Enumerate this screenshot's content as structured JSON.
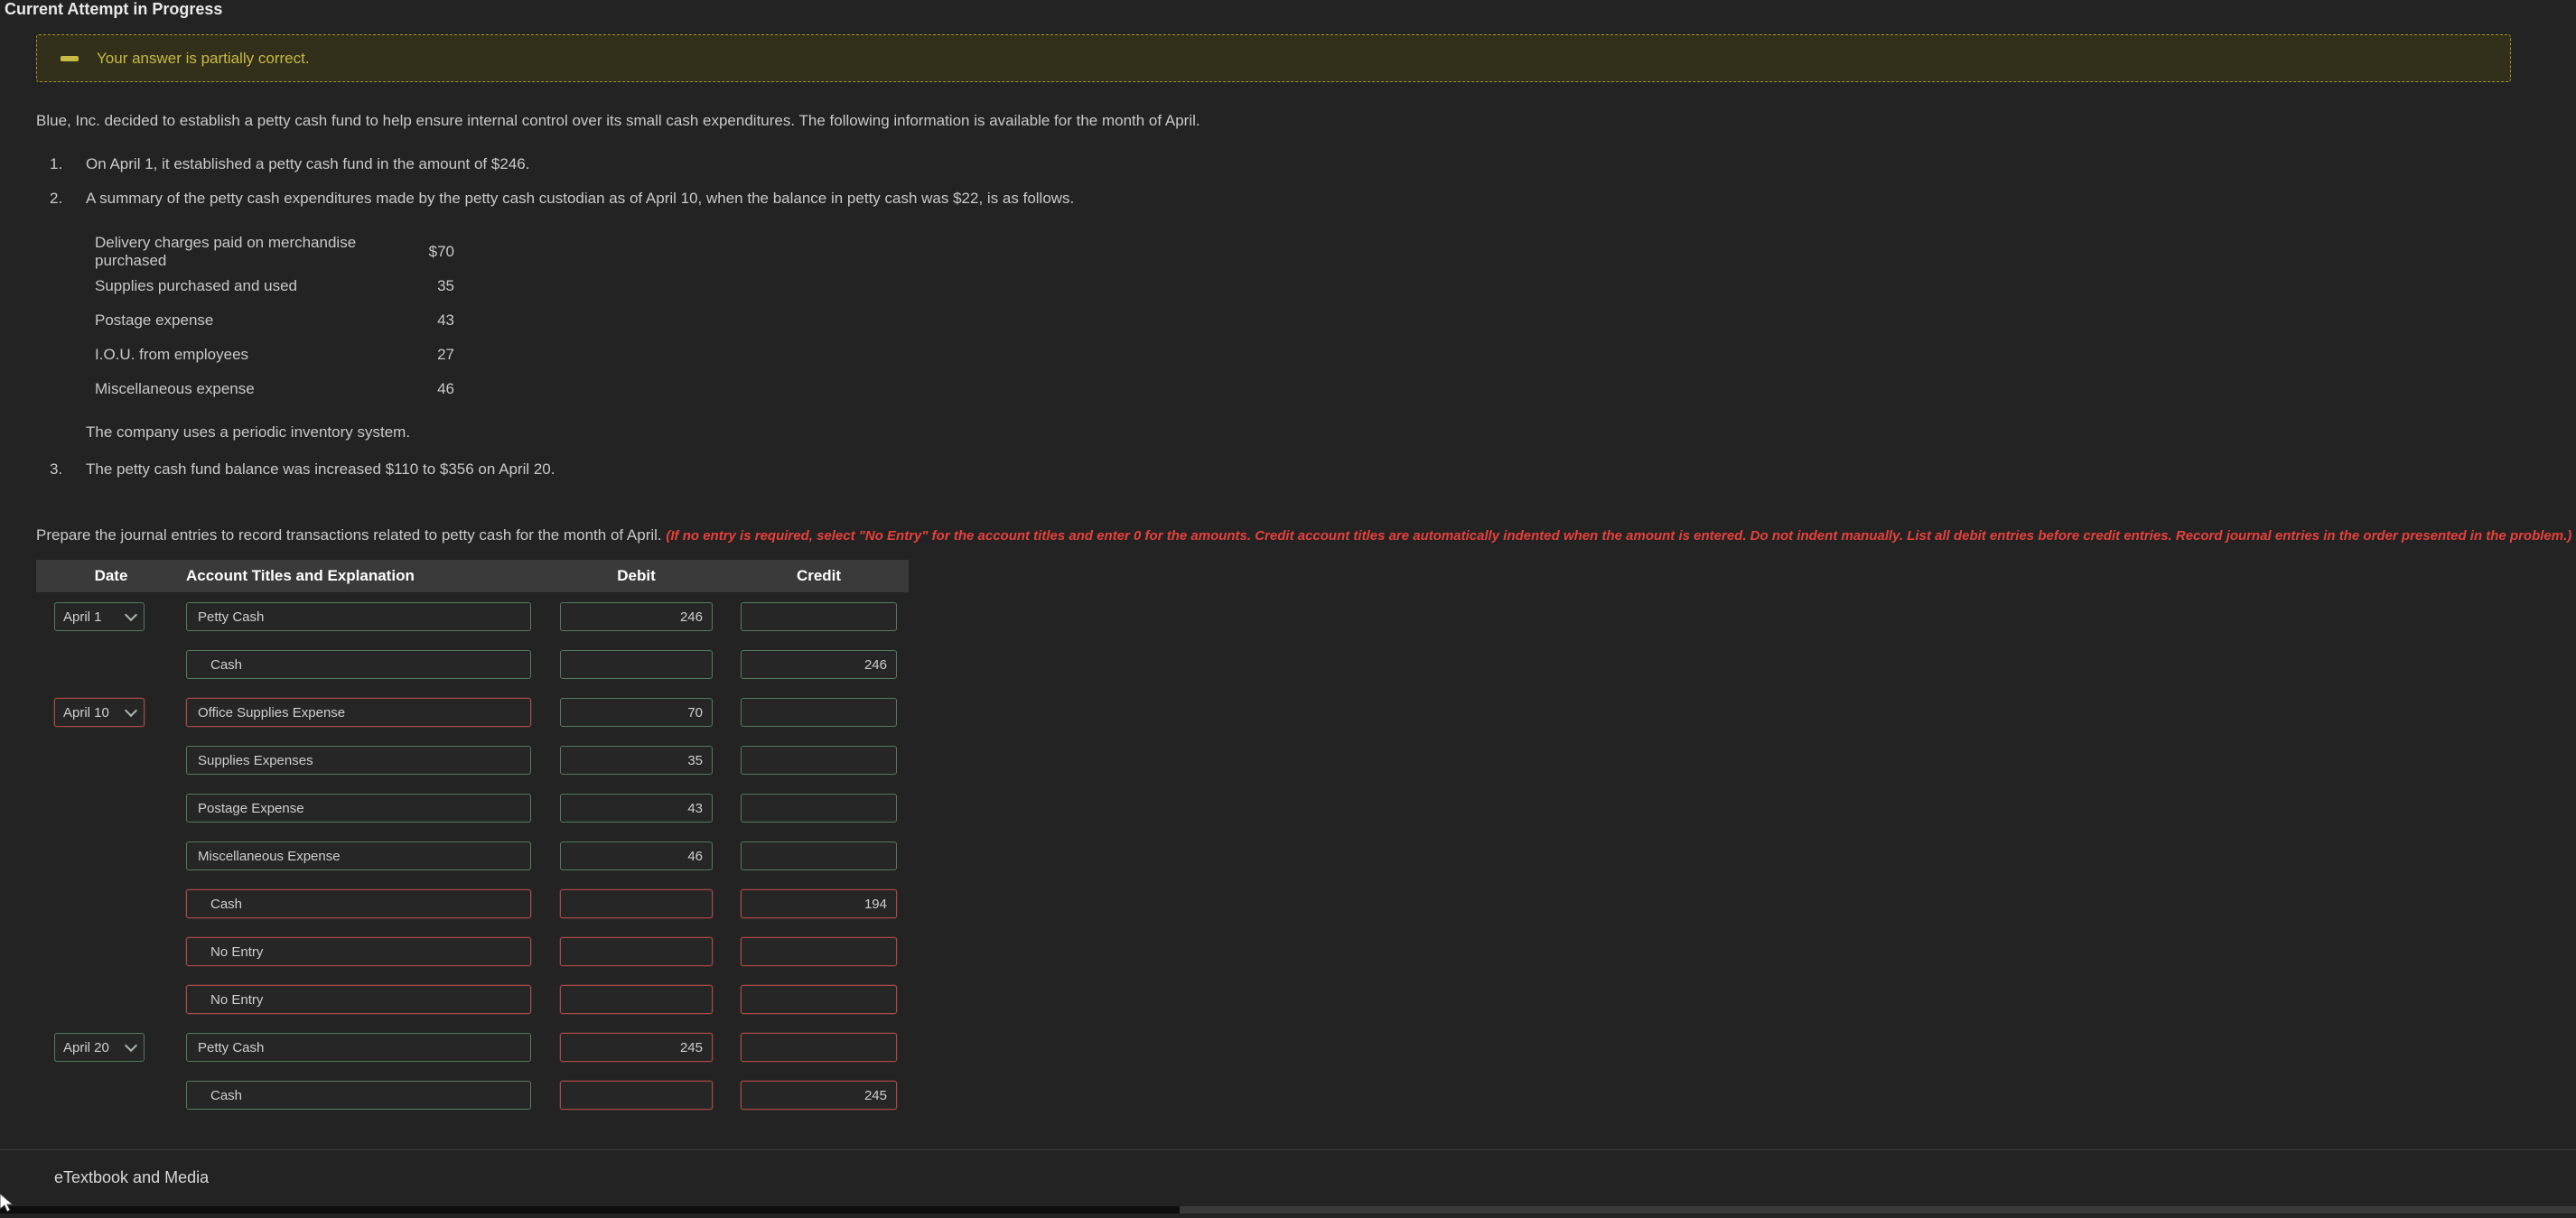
{
  "page": {
    "title": "Current Attempt in Progress",
    "footer_section": "eTextbook and Media"
  },
  "alert": {
    "message": "Your answer is partially correct.",
    "icon": "partially-correct-dash-icon"
  },
  "problem": {
    "intro": "Blue, Inc. decided to establish a petty cash fund to help ensure internal control over its small cash expenditures. The following information is available for the month of April.",
    "items": [
      {
        "number": "1.",
        "text": "On April 1, it established a petty cash fund in the amount of $246."
      },
      {
        "number": "2.",
        "text": "A summary of the petty cash expenditures made by the petty cash custodian as of April 10, when the balance in petty cash was $22, is as follows."
      },
      {
        "number": "3.",
        "text": "The petty cash fund balance was increased $110 to $356 on April 20."
      }
    ],
    "expenditures": [
      {
        "label": "Delivery charges paid on merchandise purchased",
        "amount": "$70"
      },
      {
        "label": "Supplies purchased and used",
        "amount": "35"
      },
      {
        "label": "Postage expense",
        "amount": "43"
      },
      {
        "label": "I.O.U. from employees",
        "amount": "27"
      },
      {
        "label": "Miscellaneous expense",
        "amount": "46"
      }
    ],
    "note": "The company uses a periodic inventory system.",
    "instruction": "Prepare the journal entries to record transactions related to petty cash for the month of April.",
    "instruction_warning": "(If no entry is required, select \"No Entry\" for the account titles and enter 0 for the amounts. Credit account titles are automatically indented when the amount is entered. Do not indent manually. List all debit entries before credit entries. Record journal entries in the order presented in the problem.)"
  },
  "journal": {
    "headers": {
      "date": "Date",
      "account": "Account Titles and Explanation",
      "debit": "Debit",
      "credit": "Credit"
    },
    "rows": [
      {
        "date": "April 1",
        "date_state": "correct",
        "account": "Petty Cash",
        "account_state": "correct",
        "debit": "246",
        "debit_state": "correct",
        "credit": "",
        "credit_state": "correct"
      },
      {
        "date": "",
        "date_state": "",
        "account": "Cash",
        "account_state": "correct",
        "debit": "",
        "debit_state": "correct",
        "credit": "246",
        "credit_state": "correct"
      },
      {
        "date": "April 10",
        "date_state": "incorrect",
        "account": "Office Supplies Expense",
        "account_state": "incorrect",
        "debit": "70",
        "debit_state": "correct",
        "credit": "",
        "credit_state": "correct"
      },
      {
        "date": "",
        "date_state": "",
        "account": "Supplies Expenses",
        "account_state": "correct",
        "debit": "35",
        "debit_state": "correct",
        "credit": "",
        "credit_state": "correct"
      },
      {
        "date": "",
        "date_state": "",
        "account": "Postage Expense",
        "account_state": "correct",
        "debit": "43",
        "debit_state": "correct",
        "credit": "",
        "credit_state": "correct"
      },
      {
        "date": "",
        "date_state": "",
        "account": "Miscellaneous Expense",
        "account_state": "correct",
        "debit": "46",
        "debit_state": "correct",
        "credit": "",
        "credit_state": "correct"
      },
      {
        "date": "",
        "date_state": "",
        "account": "Cash",
        "account_state": "incorrect",
        "debit": "",
        "debit_state": "incorrect",
        "credit": "194",
        "credit_state": "incorrect"
      },
      {
        "date": "",
        "date_state": "",
        "account": "No Entry",
        "account_state": "incorrect",
        "debit": "",
        "debit_state": "incorrect",
        "credit": "",
        "credit_state": "incorrect"
      },
      {
        "date": "",
        "date_state": "",
        "account": "No Entry",
        "account_state": "incorrect",
        "debit": "",
        "debit_state": "incorrect",
        "credit": "",
        "credit_state": "incorrect"
      },
      {
        "date": "April 20",
        "date_state": "correct",
        "account": "Petty Cash",
        "account_state": "correct",
        "debit": "245",
        "debit_state": "incorrect",
        "credit": "",
        "credit_state": "incorrect"
      },
      {
        "date": "",
        "date_state": "",
        "account": "Cash",
        "account_state": "correct",
        "debit": "",
        "debit_state": "incorrect",
        "credit": "245",
        "credit_state": "incorrect"
      }
    ]
  },
  "colors": {
    "page_bg": "#232323",
    "header_bg": "#3a3a3a",
    "correct_border": "#567a5f",
    "incorrect_border": "#a84a4a",
    "warning_text": "#c9b945",
    "warning_border": "#a59428",
    "error_text": "#e8413c"
  }
}
